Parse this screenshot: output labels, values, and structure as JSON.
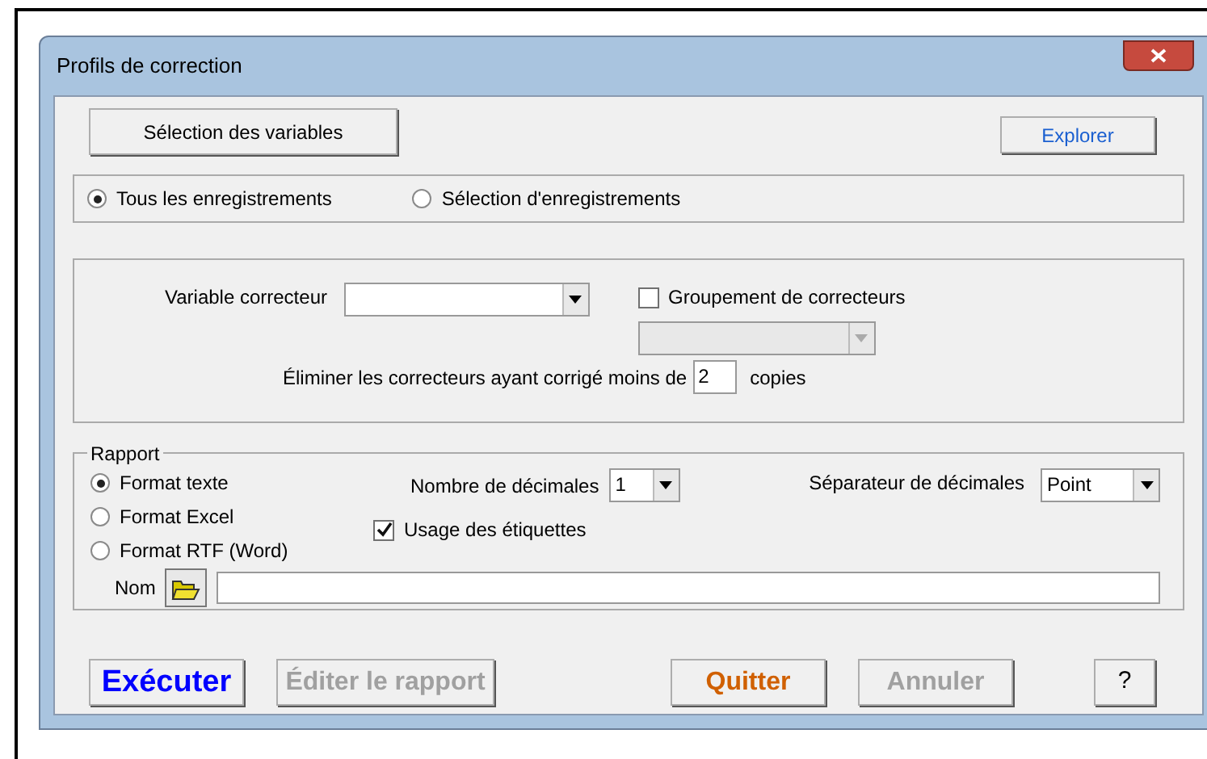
{
  "window": {
    "title": "Profils de correction"
  },
  "top_buttons": [
    {
      "label": "Sélection des variables"
    },
    {
      "label": "Explorer"
    }
  ],
  "records": [
    {
      "label": "Tous les enregistrements",
      "selected": true
    },
    {
      "label": "Sélection d'enregistrements",
      "selected": false
    }
  ],
  "correcteur": {
    "variable_label": "Variable correcteur",
    "grouping": {
      "label": "Groupement de correcteurs",
      "checked": false
    },
    "grouping_dropdown": {
      "disabled": true
    },
    "eliminate_label": "Éliminer les correcteurs ayant corrigé moins de",
    "eliminate_value": "2",
    "eliminate_suffix": "copies"
  },
  "rapport": {
    "legend": "Rapport",
    "formats": [
      {
        "label": "Format texte",
        "selected": true
      },
      {
        "label": "Format Excel",
        "selected": false
      },
      {
        "label": "Format RTF (Word)",
        "selected": false
      }
    ],
    "decimals": {
      "label": "Nombre de décimales",
      "value": "1"
    },
    "separator": {
      "label": "Séparateur de décimales",
      "value": "Point"
    },
    "labels_option": {
      "label": "Usage des étiquettes",
      "checked": true
    },
    "name_label": "Nom"
  },
  "footer_buttons": [
    {
      "label": "Exécuter",
      "color": "#0000ff",
      "disabled": false
    },
    {
      "label": "Éditer le rapport",
      "disabled": true
    },
    {
      "label": "Quitter",
      "color": "#d06000",
      "disabled": false
    },
    {
      "label": "Annuler",
      "disabled": true
    },
    {
      "label": "?",
      "disabled": false
    }
  ]
}
